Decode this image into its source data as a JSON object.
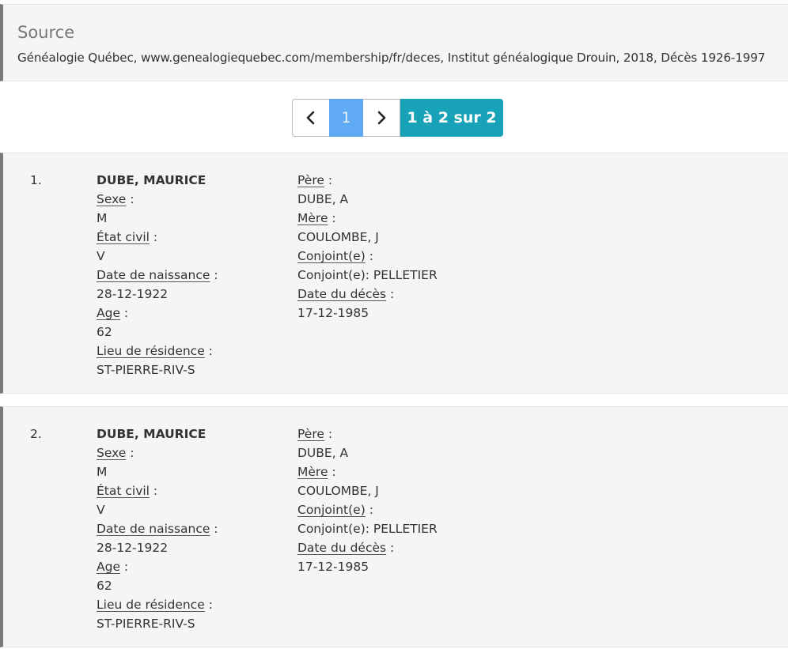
{
  "source": {
    "title": "Source",
    "text": "Généalogie Québec, www.genealogiequebec.com/membership/fr/deces, Institut généalogique Drouin, 2018, Décès 1926-1997"
  },
  "pagination": {
    "prev_icon": "chevron-left-icon",
    "next_icon": "chevron-right-icon",
    "current_page": "1",
    "count_label": "1 à 2 sur 2"
  },
  "labels": {
    "sexe": "Sexe",
    "etat_civil": "État civil",
    "date_naissance": "Date de naissance",
    "age": "Age",
    "lieu_residence": "Lieu de résidence",
    "pere": "Père",
    "mere": "Mère",
    "conjoint": "Conjoint(e)",
    "date_deces": "Date du décès",
    "colon": " :"
  },
  "records": [
    {
      "number": "1.",
      "name": "DUBE, MAURICE",
      "sexe": "M",
      "etat_civil": "V",
      "date_naissance": "28-12-1922",
      "age": "62",
      "lieu_residence": "ST-PIERRE-RIV-S",
      "pere": "DUBE, A",
      "mere": "COULOMBE, J",
      "conjoint": "Conjoint(e): PELLETIER",
      "date_deces": "17-12-1985"
    },
    {
      "number": "2.",
      "name": "DUBE, MAURICE",
      "sexe": "M",
      "etat_civil": "V",
      "date_naissance": "28-12-1922",
      "age": "62",
      "lieu_residence": "ST-PIERRE-RIV-S",
      "pere": "DUBE, A",
      "mere": "COULOMBE, J",
      "conjoint": "Conjoint(e): PELLETIER",
      "date_deces": "17-12-1985"
    }
  ]
}
